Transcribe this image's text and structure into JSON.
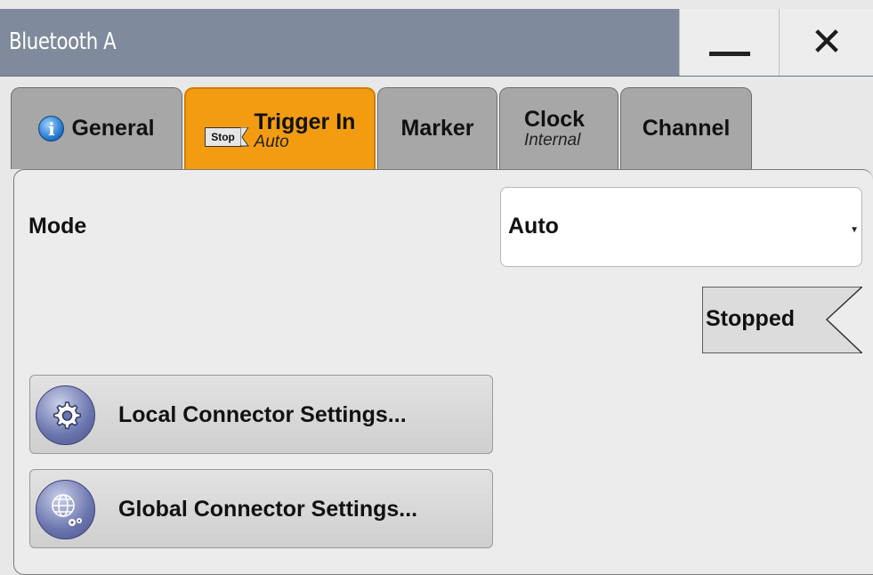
{
  "window": {
    "title": "Bluetooth A",
    "minimize_icon": "minimize-icon",
    "close_icon": "close-icon",
    "close_glyph": "✕"
  },
  "tabs": [
    {
      "label": "General",
      "sub": "",
      "icon": "info-icon",
      "icon_glyph": "i",
      "active": false
    },
    {
      "label": "Trigger In",
      "sub": "Auto",
      "icon": "stop-flag-icon",
      "icon_text": "Stop",
      "active": true
    },
    {
      "label": "Marker",
      "sub": "",
      "active": false
    },
    {
      "label": "Clock",
      "sub": "Internal",
      "active": false
    },
    {
      "label": "Channel",
      "sub": "",
      "active": false
    }
  ],
  "trigger": {
    "mode_label": "Mode",
    "mode_value": "Auto",
    "status": "Stopped"
  },
  "buttons": {
    "local": "Local Connector Settings...",
    "global": "Global Connector Settings..."
  },
  "colors": {
    "titlebar": "#7f8a9c",
    "active_tab": "#f39c12",
    "inactive_tab": "#a7a7a7",
    "panel": "#ececec"
  }
}
